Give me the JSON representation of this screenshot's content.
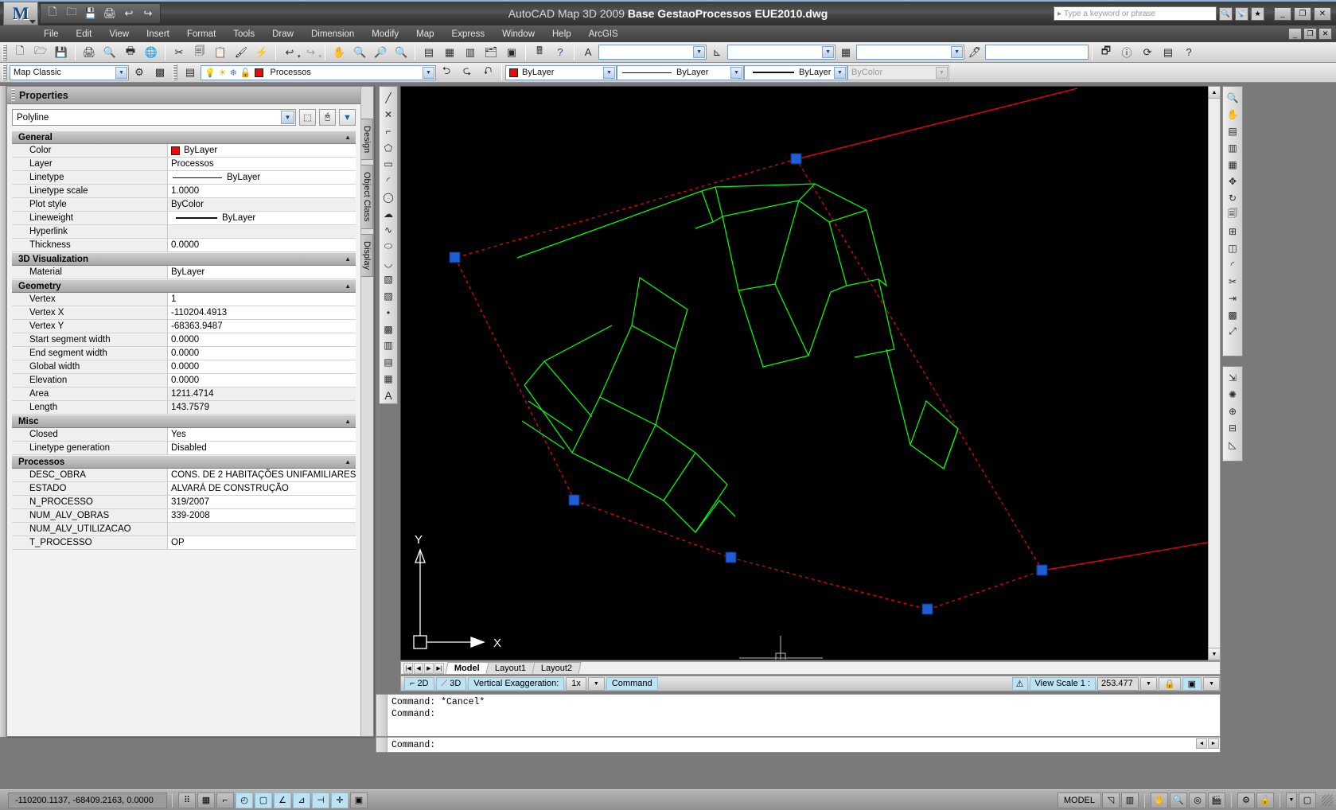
{
  "titlebar": {
    "app_title_prefix": "AutoCAD Map 3D 2009",
    "document_name": "Base GestaoProcessos EUE2010.dwg",
    "search_placeholder": "Type a keyword or phrase",
    "quick_access": [
      "new-icon",
      "open-icon",
      "save-icon",
      "print-icon",
      "undo-icon",
      "redo-icon"
    ],
    "window_buttons": [
      "minimize",
      "restore",
      "close"
    ]
  },
  "menu": {
    "items": [
      "File",
      "Edit",
      "View",
      "Insert",
      "Format",
      "Tools",
      "Draw",
      "Dimension",
      "Modify",
      "Map",
      "Express",
      "Window",
      "Help",
      "ArcGIS"
    ]
  },
  "toolbars": {
    "row1_icons": [
      "new-icon",
      "open-icon",
      "save-icon",
      "plot-icon",
      "preview-icon",
      "publish-icon",
      "3dorbit-globe-icon",
      "cut-icon",
      "copy-icon",
      "paste-icon",
      "matchprop-icon",
      "blockeditor-icon",
      "undo-icon",
      "redo-icon",
      "pan-icon",
      "zoom-icon",
      "zoom-window-icon",
      "zoom-previous-icon",
      "properties-icon",
      "designcenter-icon",
      "toolpalettes-icon",
      "sheetset-icon",
      "markup-icon",
      "help-icon"
    ],
    "row1_right_icons": [
      "manage-xrefs-icon",
      "info-icon",
      "refresh-icon",
      "layers-icon",
      "help2-icon"
    ],
    "text_style_combo": "",
    "dim_style_combo": "",
    "table_style_combo": "",
    "multileader_combo": "",
    "workspace_label": "Map Classic",
    "layer_name": "Processos",
    "color_value": "ByLayer",
    "color_hex": "#ff0000",
    "linetype_value": "ByLayer",
    "lineweight_value": "ByLayer",
    "plotstyle_value": "ByColor"
  },
  "properties": {
    "panel_title": "Properties",
    "object_type": "Polyline",
    "header_buttons": [
      "quick-select-icon",
      "toggle-pickadd-icon",
      "select-objects-icon"
    ],
    "vertical_tabs": [
      "Design",
      "Object Class",
      "Display"
    ],
    "groups": [
      {
        "name": "General",
        "rows": [
          {
            "key": "Color",
            "value": "ByLayer",
            "swatch": "#ff0000"
          },
          {
            "key": "Layer",
            "value": "Processos"
          },
          {
            "key": "Linetype",
            "value": "ByLayer",
            "linetype": true
          },
          {
            "key": "Linetype scale",
            "value": "1.0000"
          },
          {
            "key": "Plot style",
            "value": "ByColor"
          },
          {
            "key": "Lineweight",
            "value": "ByLayer",
            "lineweight": true
          },
          {
            "key": "Hyperlink",
            "value": ""
          },
          {
            "key": "Thickness",
            "value": "0.0000"
          }
        ]
      },
      {
        "name": "3D Visualization",
        "rows": [
          {
            "key": "Material",
            "value": "ByLayer"
          }
        ]
      },
      {
        "name": "Geometry",
        "rows": [
          {
            "key": "Vertex",
            "value": "1"
          },
          {
            "key": "Vertex X",
            "value": "-110204.4913"
          },
          {
            "key": "Vertex Y",
            "value": "-68363.9487"
          },
          {
            "key": "Start segment width",
            "value": "0.0000"
          },
          {
            "key": "End segment width",
            "value": "0.0000"
          },
          {
            "key": "Global width",
            "value": "0.0000"
          },
          {
            "key": "Elevation",
            "value": "0.0000"
          },
          {
            "key": "Area",
            "value": "1211.4714"
          },
          {
            "key": "Length",
            "value": "143.7579"
          }
        ]
      },
      {
        "name": "Misc",
        "rows": [
          {
            "key": "Closed",
            "value": "Yes"
          },
          {
            "key": "Linetype generation",
            "value": "Disabled"
          }
        ]
      },
      {
        "name": "Processos",
        "rows": [
          {
            "key": "DESC_OBRA",
            "value": "CONS. DE 2 HABITAÇÕES UNIFAMILIARES ..."
          },
          {
            "key": "ESTADO",
            "value": "ALVARÁ DE CONSTRUÇÃO"
          },
          {
            "key": "N_PROCESSO",
            "value": "319/2007"
          },
          {
            "key": "NUM_ALV_OBRAS",
            "value": "339-2008"
          },
          {
            "key": "NUM_ALV_UTILIZACAO",
            "value": ""
          },
          {
            "key": "T_PROCESSO",
            "value": "OP"
          }
        ]
      }
    ]
  },
  "drawing": {
    "background_hex": "#000000",
    "parcel_color_hex": "#ff0000",
    "building_color_hex": "#00ff00",
    "grip_color_hex": "#2255dd",
    "ucs_x_label": "X",
    "ucs_y_label": "Y"
  },
  "model_tabs": {
    "nav_buttons": [
      "first-icon",
      "prev-icon",
      "next-icon",
      "last-icon"
    ],
    "tabs": [
      "Model",
      "Layout1",
      "Layout2"
    ],
    "selected": "Model"
  },
  "bar3d": {
    "mode_2d": "2D",
    "mode_3d": "3D",
    "vertical_exaggeration_label": "Vertical Exaggeration:",
    "vertical_exaggeration_value": "1x",
    "command_label": "Command",
    "view_scale_label": "View Scale  1 :",
    "view_scale_value": "253.477",
    "warning_icon": "warning-triangle-icon",
    "lock_icon": "lock-icon",
    "display_icon": "display-manager-icon"
  },
  "command_window": {
    "lines": [
      "Command: *Cancel*",
      "Command:"
    ],
    "prompt": "Command:"
  },
  "status_bar": {
    "coordinates": "-110200.1137, -68409.2163, 0.0000",
    "toggles": [
      {
        "name": "snap-icon",
        "on": false
      },
      {
        "name": "grid-icon",
        "on": false
      },
      {
        "name": "ortho-icon",
        "on": false
      },
      {
        "name": "polar-icon",
        "on": true
      },
      {
        "name": "osnap-icon",
        "on": true
      },
      {
        "name": "otrack-icon",
        "on": true
      },
      {
        "name": "ducs-icon",
        "on": true
      },
      {
        "name": "dyn-icon",
        "on": true
      },
      {
        "name": "lineweight-icon",
        "on": true
      },
      {
        "name": "model-paper-icon",
        "on": false
      }
    ],
    "model_label": "MODEL",
    "right_icons": [
      "maximize-viewport-icon",
      "tile-viewport-icon",
      "pan-icon",
      "zoom-icon",
      "steering-wheel-icon",
      "showmotion-icon",
      "settings-icon",
      "lock-icon",
      "toolbar-menu-icon",
      "clean-screen-icon"
    ]
  }
}
